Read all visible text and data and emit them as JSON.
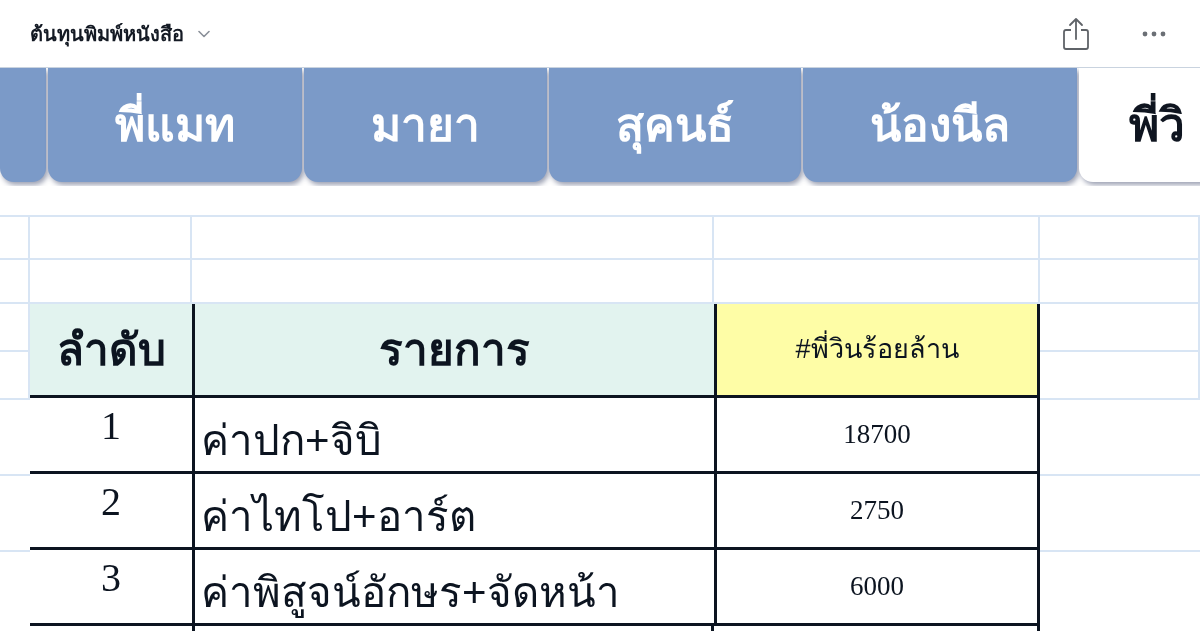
{
  "document": {
    "title": "ต้นทุนพิมพ์หนังสือ"
  },
  "sheet_tabs": [
    {
      "selected": false
    },
    {
      "label": "พี่แมท",
      "selected": false
    },
    {
      "label": "มายา",
      "selected": false
    },
    {
      "label": "สุคนธ์",
      "selected": false
    },
    {
      "label": "น้องนีล",
      "selected": false
    },
    {
      "label": "พี่วิ",
      "selected": true
    }
  ],
  "table": {
    "columns": [
      {
        "label": "ลำดับ",
        "color": "#e2f3ef"
      },
      {
        "label": "รายการ",
        "color": "#e2f3ef"
      },
      {
        "label": "#พี่วินร้อยล้าน",
        "color": "#fefda6"
      }
    ],
    "rows": [
      [
        "1",
        "ค่าปก+จิบิ",
        "18700"
      ],
      [
        "2",
        "ค่าไทโป+อาร์ต",
        "2750"
      ],
      [
        "3",
        "ค่าพิสูจน์อักษร+จัดหน้า",
        "6000"
      ]
    ]
  }
}
